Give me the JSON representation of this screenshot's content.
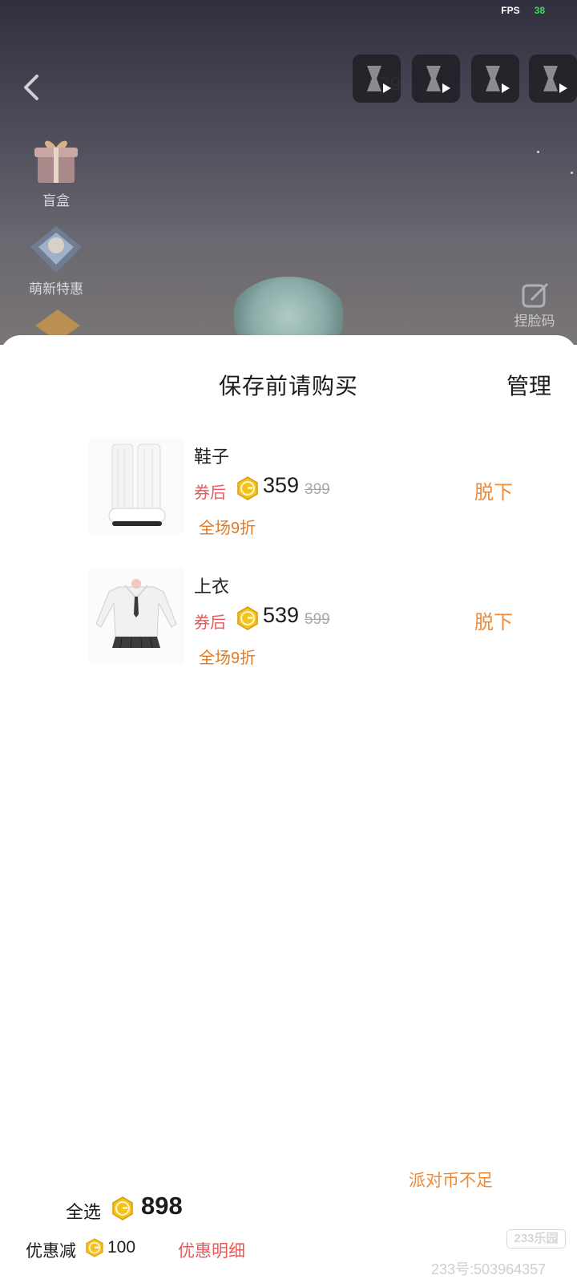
{
  "status": {
    "fps_label": "FPS",
    "fps_value": "38"
  },
  "game": {
    "coin_ghost_text": "079",
    "side_menu": [
      {
        "label": "盲盒",
        "icon": "gift-box-icon"
      },
      {
        "label": "萌新特惠",
        "icon": "newbie-deal-icon"
      }
    ],
    "face_code_label": "捏脸码",
    "ad_buttons": [
      "hourglass-play-icon",
      "hourglass-play-icon",
      "hourglass-play-icon",
      "hourglass-play-icon"
    ]
  },
  "sheet": {
    "title": "保存前请购买",
    "manage_label": "管理",
    "items": [
      {
        "name": "鞋子",
        "after_coupon_label": "券后",
        "price": "359",
        "original_price": "399",
        "discount_tag": "全场9折",
        "take_off_label": "脱下",
        "thumbnail": "white-boots-image"
      },
      {
        "name": "上衣",
        "after_coupon_label": "券后",
        "price": "539",
        "original_price": "599",
        "discount_tag": "全场9折",
        "take_off_label": "脱下",
        "thumbnail": "white-sweater-image"
      }
    ]
  },
  "footer": {
    "insufficient_label": "派对币不足",
    "select_all_label": "全选",
    "total": "898",
    "discount_label": "优惠减",
    "discount_value": "100",
    "detail_link": "优惠明细"
  },
  "watermark": {
    "logo_text": "233乐园",
    "id_text": "233号:503964357"
  },
  "colors": {
    "accent_orange": "#ef8a35",
    "red": "#e55a5a",
    "coin_gold": "#f4c21c"
  }
}
